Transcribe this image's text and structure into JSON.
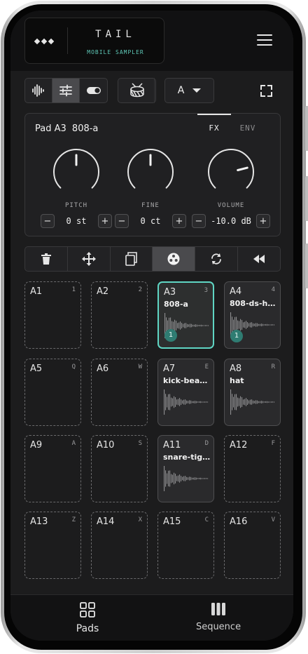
{
  "app": {
    "title": "TAIL",
    "subtitle": "MOBILE SAMPLER"
  },
  "toolbar": {
    "modes": [
      {
        "icon": "waveform-icon",
        "active": false
      },
      {
        "icon": "sliders-icon",
        "active": true
      },
      {
        "icon": "toggle-icon",
        "active": false
      }
    ],
    "kit_icon": "drum-icon",
    "bank": {
      "value": "A"
    }
  },
  "panel": {
    "pad_label": "Pad A3",
    "sample_name": "808-a",
    "tabs": [
      {
        "label": "FX",
        "active": true
      },
      {
        "label": "ENV",
        "active": false
      }
    ],
    "knobs": [
      {
        "label": "PITCH",
        "value": "0 st",
        "level": 0.5
      },
      {
        "label": "FINE",
        "value": "0 ct",
        "level": 0.5
      },
      {
        "label": "VOLUME",
        "value": "-10.0 dB",
        "level": 0.78
      }
    ],
    "minus": "−",
    "plus": "+"
  },
  "actions": [
    {
      "icon": "trash-icon",
      "active": false
    },
    {
      "icon": "move-icon",
      "active": false
    },
    {
      "icon": "copy-icon",
      "active": false
    },
    {
      "icon": "resample-icon",
      "active": true
    },
    {
      "icon": "loop-icon",
      "active": false
    },
    {
      "icon": "rewind-icon",
      "active": false
    }
  ],
  "pads": [
    {
      "id": "A1",
      "key": "1",
      "sample": "",
      "count": ""
    },
    {
      "id": "A2",
      "key": "2",
      "sample": "",
      "count": ""
    },
    {
      "id": "A3",
      "key": "3",
      "sample": "808-a",
      "count": "1",
      "selected": true
    },
    {
      "id": "A4",
      "key": "4",
      "sample": "808-ds-hi...",
      "count": "1"
    },
    {
      "id": "A5",
      "key": "Q",
      "sample": "",
      "count": ""
    },
    {
      "id": "A6",
      "key": "W",
      "sample": "",
      "count": ""
    },
    {
      "id": "A7",
      "key": "E",
      "sample": "kick-beater",
      "count": ""
    },
    {
      "id": "A8",
      "key": "R",
      "sample": "hat",
      "count": ""
    },
    {
      "id": "A9",
      "key": "A",
      "sample": "",
      "count": ""
    },
    {
      "id": "A10",
      "key": "S",
      "sample": "",
      "count": ""
    },
    {
      "id": "A11",
      "key": "D",
      "sample": "snare-tight",
      "count": ""
    },
    {
      "id": "A12",
      "key": "F",
      "sample": "",
      "count": ""
    },
    {
      "id": "A13",
      "key": "Z",
      "sample": "",
      "count": ""
    },
    {
      "id": "A14",
      "key": "X",
      "sample": "",
      "count": ""
    },
    {
      "id": "A15",
      "key": "C",
      "sample": "",
      "count": ""
    },
    {
      "id": "A16",
      "key": "V",
      "sample": "",
      "count": ""
    }
  ],
  "nav": [
    {
      "label": "Pads",
      "icon": "grid-icon",
      "active": true
    },
    {
      "label": "Sequence",
      "icon": "bars-icon",
      "active": false
    }
  ],
  "colors": {
    "accent": "#5fd6c4",
    "background": "#1c1c1d",
    "badge": "#2f7c72"
  }
}
